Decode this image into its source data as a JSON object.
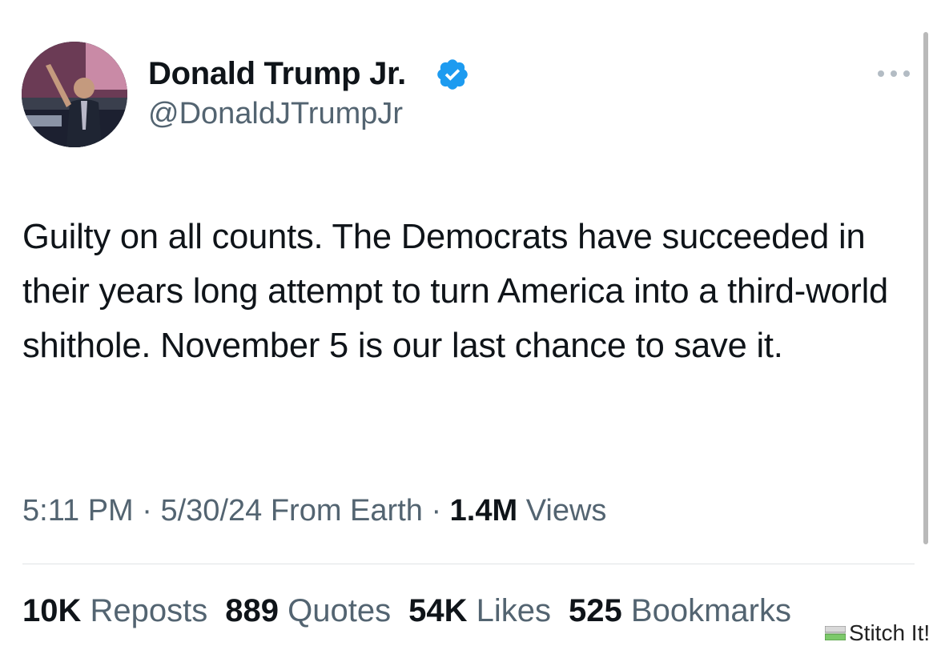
{
  "author": {
    "display_name": "Donald Trump Jr.",
    "handle": "@DonaldJTrumpJr",
    "verified": true,
    "verified_color": "#1d9bf0"
  },
  "tweet": {
    "text": "Guilty on all counts. The Democrats have succeeded in their years long attempt to turn America into a third-world shithole. November 5 is our last chance to save it."
  },
  "meta": {
    "time": "5:11 PM",
    "date": "5/30/24",
    "source": "From Earth",
    "separator": "·",
    "views_count": "1.4M",
    "views_label": "Views"
  },
  "stats": [
    {
      "count": "10K",
      "label": "Reposts"
    },
    {
      "count": "889",
      "label": "Quotes"
    },
    {
      "count": "54K",
      "label": "Likes"
    },
    {
      "count": "525",
      "label": "Bookmarks"
    }
  ],
  "watermark": {
    "label": "Stitch It!"
  },
  "icons": {
    "more": "more-horizontal-icon",
    "verified": "verified-badge-icon"
  },
  "colors": {
    "text_primary": "#0f1419",
    "text_secondary": "#536471",
    "divider": "#dfe3e6"
  }
}
